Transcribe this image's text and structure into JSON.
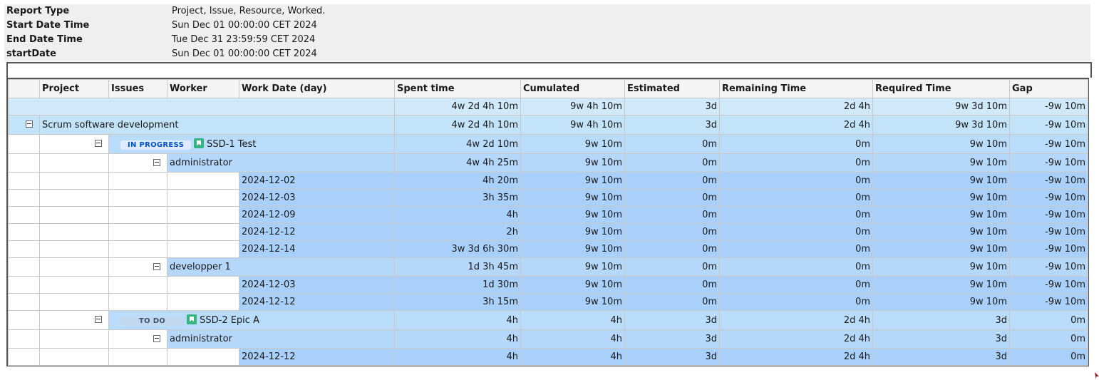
{
  "header": {
    "rows": [
      {
        "label": "Report Type",
        "value": "Project, Issue, Resource, Worked."
      },
      {
        "label": "Start Date Time",
        "value": "Sun Dec 01 00:00:00 CET 2024"
      },
      {
        "label": "End Date Time",
        "value": "Tue Dec 31 23:59:59 CET 2024"
      },
      {
        "label": "startDate",
        "value": "Sun Dec 01 00:00:00 CET 2024"
      }
    ]
  },
  "columns": [
    "Project",
    "Issues",
    "Worker",
    "Work Date (day)",
    "Spent time",
    "Cumulated",
    "Estimated",
    "Remaining Time",
    "Required Time",
    "Gap"
  ],
  "total": {
    "spent": "4w 2d 4h 10m",
    "cumulated": "9w 4h 10m",
    "estimated": "3d",
    "remaining": "2d 4h",
    "required": "9w 3d 10m",
    "gap": "-9w 10m"
  },
  "project": {
    "name": "Scrum software development",
    "spent": "4w 2d 4h 10m",
    "cumulated": "9w 4h 10m",
    "estimated": "3d",
    "remaining": "2d 4h",
    "required": "9w 3d 10m",
    "gap": "-9w 10m"
  },
  "issues": [
    {
      "status": "IN PROGRESS",
      "key_summary": "SSD-1 Test",
      "spent": "4w 2d 10m",
      "cumulated": "9w 10m",
      "estimated": "0m",
      "remaining": "0m",
      "required": "9w 10m",
      "gap": "-9w 10m",
      "workers": [
        {
          "name": "administrator",
          "spent": "4w 4h 25m",
          "cumulated": "9w 10m",
          "estimated": "0m",
          "remaining": "0m",
          "required": "9w 10m",
          "gap": "-9w 10m",
          "days": [
            {
              "date": "2024-12-02",
              "spent": "4h 20m",
              "cumulated": "9w 10m",
              "estimated": "0m",
              "remaining": "0m",
              "required": "9w 10m",
              "gap": "-9w 10m"
            },
            {
              "date": "2024-12-03",
              "spent": "3h 35m",
              "cumulated": "9w 10m",
              "estimated": "0m",
              "remaining": "0m",
              "required": "9w 10m",
              "gap": "-9w 10m"
            },
            {
              "date": "2024-12-09",
              "spent": "4h",
              "cumulated": "9w 10m",
              "estimated": "0m",
              "remaining": "0m",
              "required": "9w 10m",
              "gap": "-9w 10m"
            },
            {
              "date": "2024-12-12",
              "spent": "2h",
              "cumulated": "9w 10m",
              "estimated": "0m",
              "remaining": "0m",
              "required": "9w 10m",
              "gap": "-9w 10m"
            },
            {
              "date": "2024-12-14",
              "spent": "3w 3d 6h 30m",
              "cumulated": "9w 10m",
              "estimated": "0m",
              "remaining": "0m",
              "required": "9w 10m",
              "gap": "-9w 10m"
            }
          ]
        },
        {
          "name": "developper 1",
          "spent": "1d 3h 45m",
          "cumulated": "9w 10m",
          "estimated": "0m",
          "remaining": "0m",
          "required": "9w 10m",
          "gap": "-9w 10m",
          "days": [
            {
              "date": "2024-12-03",
              "spent": "1d 30m",
              "cumulated": "9w 10m",
              "estimated": "0m",
              "remaining": "0m",
              "required": "9w 10m",
              "gap": "-9w 10m"
            },
            {
              "date": "2024-12-12",
              "spent": "3h 15m",
              "cumulated": "9w 10m",
              "estimated": "0m",
              "remaining": "0m",
              "required": "9w 10m",
              "gap": "-9w 10m"
            }
          ]
        }
      ]
    },
    {
      "status": "TO DO",
      "key_summary": "SSD-2 Epic A",
      "spent": "4h",
      "cumulated": "4h",
      "estimated": "3d",
      "remaining": "2d 4h",
      "required": "3d",
      "gap": "0m",
      "workers": [
        {
          "name": "administrator",
          "spent": "4h",
          "cumulated": "4h",
          "estimated": "3d",
          "remaining": "2d 4h",
          "required": "3d",
          "gap": "0m",
          "days": [
            {
              "date": "2024-12-12",
              "spent": "4h",
              "cumulated": "4h",
              "estimated": "3d",
              "remaining": "2d 4h",
              "required": "3d",
              "gap": "0m"
            }
          ]
        }
      ]
    }
  ]
}
